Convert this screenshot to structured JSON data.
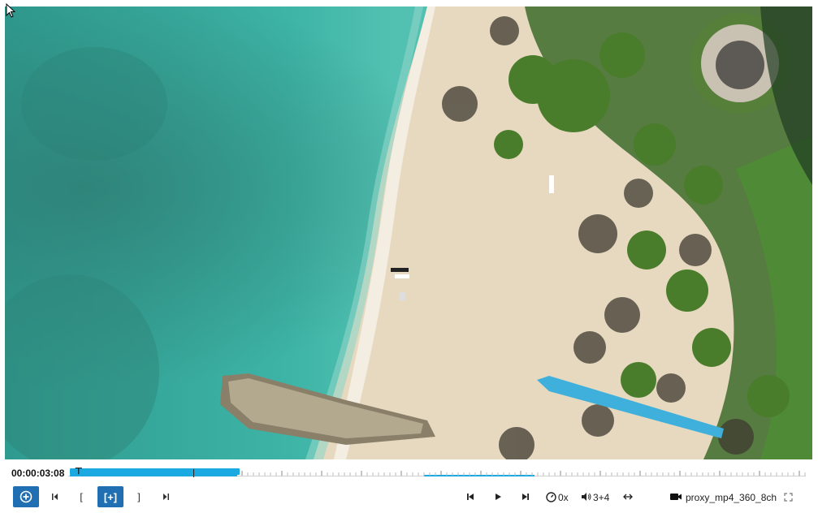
{
  "player": {
    "timecode": "00:00:03:08",
    "progress_fraction": 0.23,
    "controls": {
      "add_marker_icon": "plus-circle-icon",
      "in_point_bracket": "[",
      "add_clip_label": "[+]",
      "out_point_bracket": "]",
      "speed": "0x",
      "audio_channels": "3+4",
      "proxy_name": "proxy_mp4_360_8ch"
    },
    "icons": [
      "step-to-start-icon",
      "go-to-in-icon",
      "go-to-out-icon",
      "step-to-end-icon",
      "skip-back-icon",
      "play-icon",
      "skip-forward-icon",
      "speed-gauge-icon",
      "volume-icon",
      "loop-icon",
      "video-camera-icon",
      "fullscreen-icon"
    ]
  },
  "colors": {
    "accent": "#1f6fb2",
    "timeline_progress": "#1aa9e0"
  }
}
